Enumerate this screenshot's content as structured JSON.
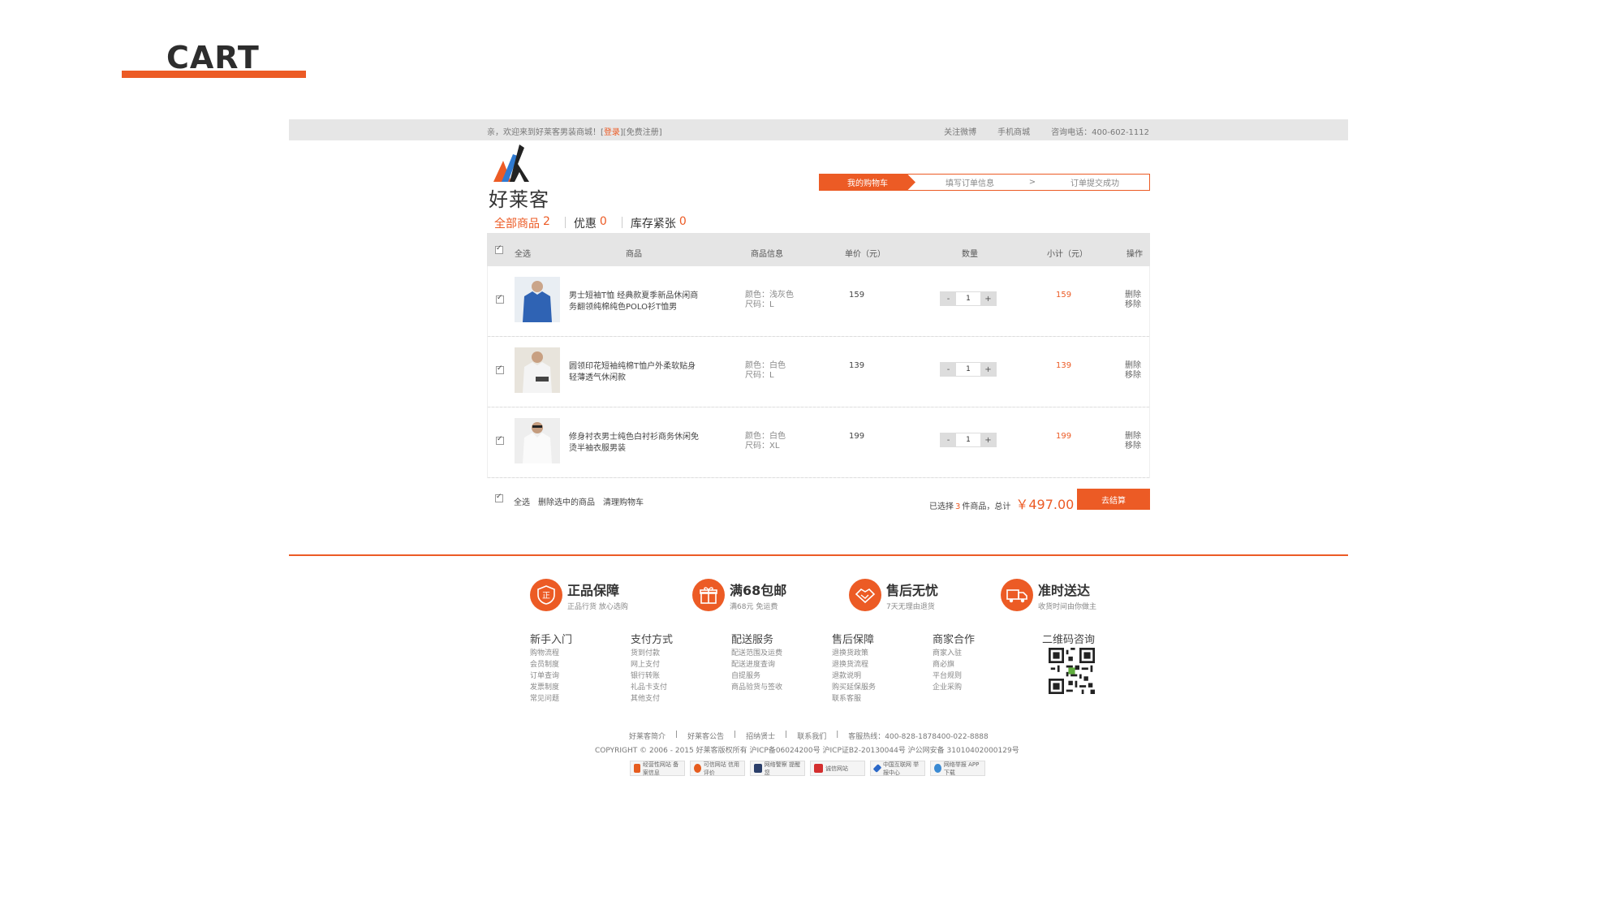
{
  "presentation": {
    "title": "CART"
  },
  "topbar": {
    "welcome_prefix": "亲，欢迎来到好莱客男装商城！[",
    "login": "登录",
    "welcome_suffix": "][免费注册]",
    "links": [
      "关注微博",
      "手机商城",
      "咨询电话：400-602-1112"
    ]
  },
  "brand": {
    "name": "好莱客"
  },
  "steps": [
    "我的购物车",
    "填写订单信息",
    ">",
    "订单提交成功"
  ],
  "tabs": [
    {
      "label": "全部商品",
      "count": "2"
    },
    {
      "label": "优惠",
      "count": "0"
    },
    {
      "label": "库存紧张",
      "count": "0"
    }
  ],
  "table_header": {
    "select_all": "全选",
    "product": "商品",
    "info": "商品信息",
    "unit_price": "单价（元）",
    "quantity": "数量",
    "subtotal": "小计（元）",
    "actions": "操作"
  },
  "items": [
    {
      "name": "男士短袖T恤 经典款夏季新品休闲商务翻领纯棉纯色POLO衫T恤男",
      "color": "颜色：浅灰色",
      "size": "尺码：L",
      "price": "159",
      "qty": "1",
      "subtotal": "159",
      "op1": "删除",
      "op2": "移除",
      "shirt_color": "#2f63b4"
    },
    {
      "name": "圆领印花短袖纯棉T恤户外柔软贴身轻薄透气休闲款",
      "color": "颜色：白色",
      "size": "尺码：L",
      "price": "139",
      "qty": "1",
      "subtotal": "139",
      "op1": "删除",
      "op2": "移除",
      "shirt_color": "#f3f3f3"
    },
    {
      "name": "修身衬衣男士纯色白衬衫商务休闲免烫半袖衣服男装",
      "color": "颜色：白色",
      "size": "尺码：XL",
      "price": "199",
      "qty": "1",
      "subtotal": "199",
      "op1": "删除",
      "op2": "移除",
      "shirt_color": "#f7f7f7"
    }
  ],
  "qty_minus": "-",
  "qty_plus": "+",
  "footer_bar": {
    "select_all": "全选",
    "delete_selected": "删除选中的商品",
    "clear_cart": "清理购物车",
    "selected_prefix": "已选择",
    "selected_count": "3",
    "selected_suffix": "件商品，总计",
    "total": "￥497.00",
    "checkout": "去结算"
  },
  "guarantees": [
    {
      "title": "正品保障",
      "sub": "正品行货  放心选购",
      "icon": "shield-icon"
    },
    {
      "title": "满68包邮",
      "sub": "满68元  免运费",
      "icon": "gift-icon"
    },
    {
      "title": "售后无忧",
      "sub": "7天无理由退货",
      "icon": "handshake-icon"
    },
    {
      "title": "准时送达",
      "sub": "收货时间由你做主",
      "icon": "truck-icon"
    }
  ],
  "footer_columns": [
    {
      "head": "新手入门",
      "items": [
        "购物流程",
        "会员制度",
        "订单查询",
        "发票制度",
        "常见问题"
      ]
    },
    {
      "head": "支付方式",
      "items": [
        "货到付款",
        "网上支付",
        "银行转账",
        "礼品卡支付",
        "其他支付"
      ]
    },
    {
      "head": "配送服务",
      "items": [
        "配送范围及运费",
        "配送进度查询",
        "自提服务",
        "商品验货与签收"
      ]
    },
    {
      "head": "售后保障",
      "items": [
        "退换货政策",
        "退换货流程",
        "退款说明",
        "购买延保服务",
        "联系客服"
      ]
    },
    {
      "head": "商家合作",
      "items": [
        "商家入驻",
        "商必旗",
        "平台规则",
        "企业采购"
      ]
    },
    {
      "head": "二维码咨询",
      "items": []
    }
  ],
  "bottom_links": [
    "好莱客简介",
    "|",
    "好莱客公告",
    "|",
    "招纳贤士",
    "|",
    "联系我们",
    "|",
    "客服热线：400-828-1878400-022-8888"
  ],
  "copyright": "COPYRIGHT © 2006 - 2015  好莱客版权所有  沪ICP备06024200号  沪ICP证B2-20130044号  沪公网安备 31010402000129号",
  "badges": [
    {
      "label": "经营性网站 备案信息",
      "color": "#e65c1e"
    },
    {
      "label": "可信网站 信用评价",
      "color": "#e65c1e"
    },
    {
      "label": "网络警察 提醒您",
      "color": "#2b3f6a"
    },
    {
      "label": "诚信网站",
      "color": "#d42e2e"
    },
    {
      "label": "中国互联网 举报中心",
      "color": "#2b68c8"
    },
    {
      "label": "网络举报 APP下载",
      "color": "#3a8ad3"
    }
  ],
  "accent_color": "#ec5b25"
}
